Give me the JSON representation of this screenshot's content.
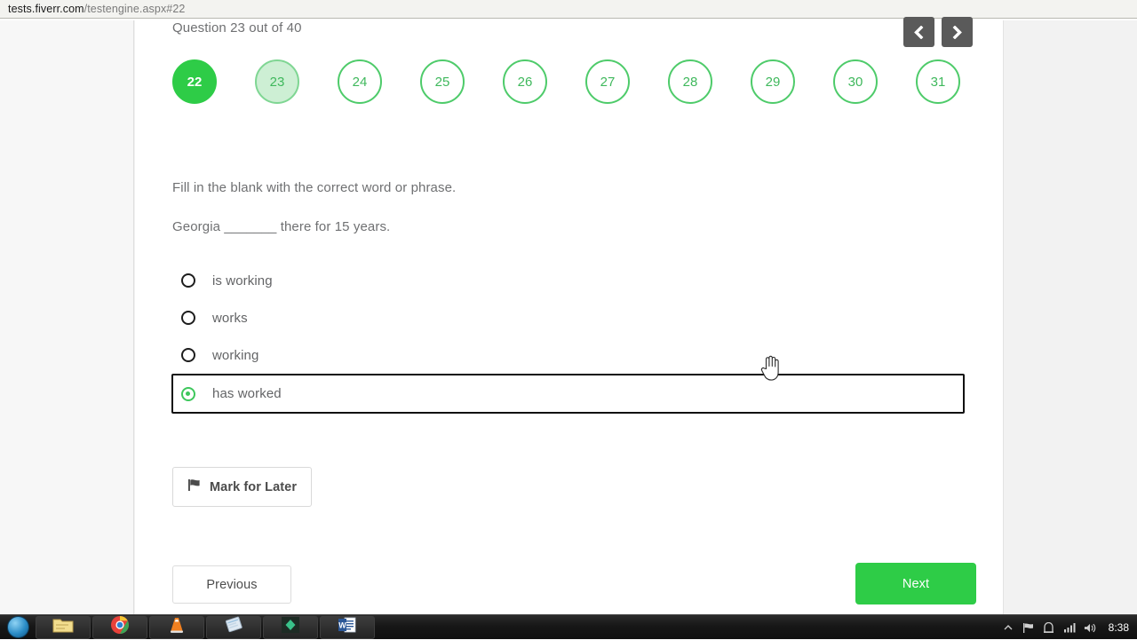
{
  "browser": {
    "url_domain": "tests.fiverr.com",
    "url_path": "/testengine.aspx#22"
  },
  "quiz": {
    "counter_text": "Question 23 out of 40",
    "prev_arrow_icon": "chevron-left-icon",
    "next_arrow_icon": "chevron-right-icon",
    "circles": [
      {
        "number": "22",
        "state": "answered"
      },
      {
        "number": "23",
        "state": "current"
      },
      {
        "number": "24",
        "state": "unanswered"
      },
      {
        "number": "25",
        "state": "unanswered"
      },
      {
        "number": "26",
        "state": "unanswered"
      },
      {
        "number": "27",
        "state": "unanswered"
      },
      {
        "number": "28",
        "state": "unanswered"
      },
      {
        "number": "29",
        "state": "unanswered"
      },
      {
        "number": "30",
        "state": "unanswered"
      },
      {
        "number": "31",
        "state": "unanswered"
      }
    ],
    "prompt": "Fill in the blank with the correct word or phrase.",
    "sentence": "Georgia _______ there for 15 years.",
    "options": [
      {
        "label": "is working",
        "selected": false
      },
      {
        "label": "works",
        "selected": false
      },
      {
        "label": "working",
        "selected": false
      },
      {
        "label": "has worked",
        "selected": true
      }
    ],
    "mark_for_later_label": "Mark for Later",
    "mark_for_later_icon": "flag-icon",
    "previous_label": "Previous",
    "next_label": "Next"
  },
  "colors": {
    "green_accent": "#2ecc47",
    "green_border": "#4ecb6a",
    "green_light_fill": "#cdefd4",
    "selection_border": "#111111"
  },
  "cursor": {
    "icon": "pointing-hand-cursor"
  },
  "taskbar": {
    "start_icon": "start-orb-icon",
    "items": [
      {
        "icon": "folder-explorer-icon"
      },
      {
        "icon": "chrome-icon"
      },
      {
        "icon": "vlc-cone-icon"
      },
      {
        "icon": "window-preview-icon"
      },
      {
        "icon": "green-diamond-app-icon"
      },
      {
        "icon": "word-icon"
      }
    ],
    "tray": [
      {
        "icon": "show-hidden-icons-icon"
      },
      {
        "icon": "network-flag-icon"
      },
      {
        "icon": "action-center-icon"
      },
      {
        "icon": "signal-bars-icon"
      },
      {
        "icon": "volume-icon"
      }
    ],
    "clock": "8:38"
  }
}
